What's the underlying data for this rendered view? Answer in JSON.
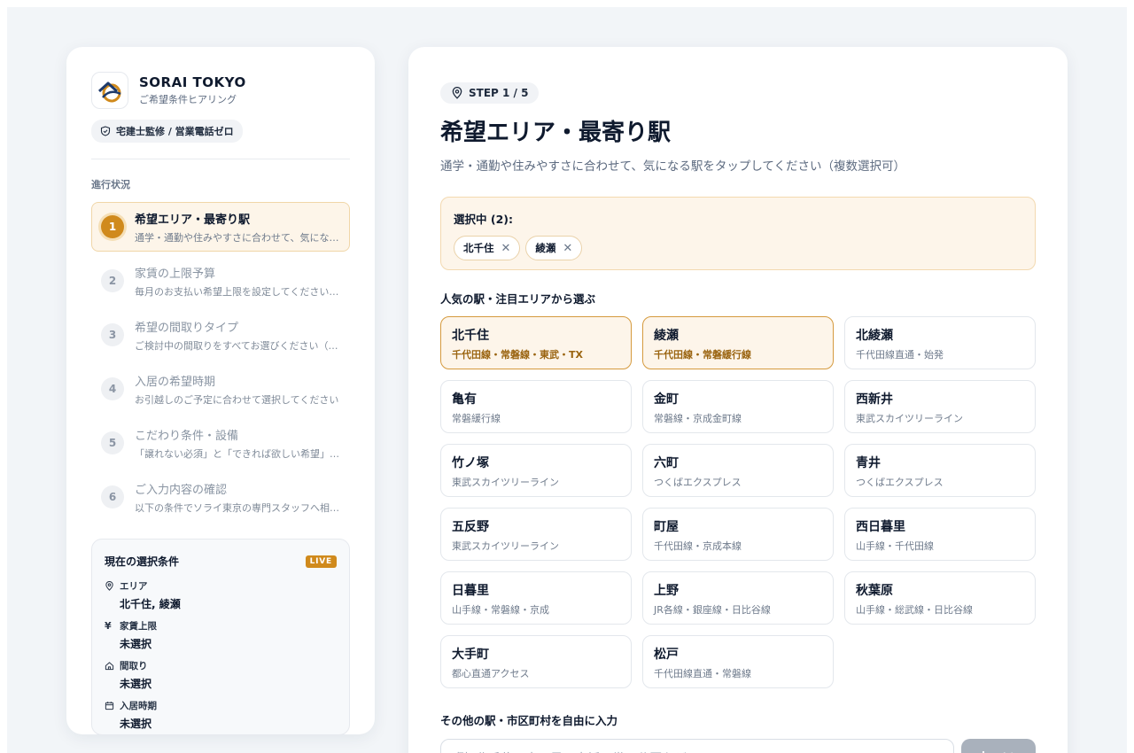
{
  "brand": {
    "name": "SORAI TOKYO",
    "subtitle": "ご希望条件ヒアリング",
    "badge": "宅建士監修 / 営業電話ゼロ"
  },
  "progress": {
    "title": "進行状況",
    "steps": [
      {
        "num": "1",
        "title": "希望エリア・最寄り駅",
        "desc": "通学・通勤や住みやすさに合わせて、気になる駅をタップしてください"
      },
      {
        "num": "2",
        "title": "家賃の上限予算",
        "desc": "毎月のお支払い希望上限を設定してください（管理費込み）"
      },
      {
        "num": "3",
        "title": "希望の間取りタイプ",
        "desc": "ご検討中の間取りをすべてお選びください（複数選択可）"
      },
      {
        "num": "4",
        "title": "入居の希望時期",
        "desc": "お引越しのご予定に合わせて選択してください"
      },
      {
        "num": "5",
        "title": "こだわり条件・設備",
        "desc": "「譲れない必須」と「できれば欲しい希望」を分けてお選びください"
      },
      {
        "num": "6",
        "title": "ご入力内容の確認",
        "desc": "以下の条件でソライ東京の専門スタッフへ相談します"
      }
    ]
  },
  "summary": {
    "title": "現在の選択条件",
    "live": "LIVE",
    "items": [
      {
        "label": "エリア",
        "value": "北千住, 綾瀬",
        "icon": "pin-icon"
      },
      {
        "label": "家賃上限",
        "value": "未選択",
        "icon": "yen-icon"
      },
      {
        "label": "間取り",
        "value": "未選択",
        "icon": "home-icon"
      },
      {
        "label": "入居時期",
        "value": "未選択",
        "icon": "calendar-icon"
      }
    ]
  },
  "main": {
    "step_chip": "STEP 1 / 5",
    "title": "希望エリア・最寄り駅",
    "subtitle": "通学・通勤や住みやすさに合わせて、気になる駅をタップしてください（複数選択可）",
    "selected_label": "選択中 (2):",
    "selected_tags": [
      "北千住",
      "綾瀬"
    ],
    "popular_label": "人気の駅・注目エリアから選ぶ",
    "stations": [
      {
        "name": "北千住",
        "line": "千代田線・常磐線・東武・TX",
        "selected": true
      },
      {
        "name": "綾瀬",
        "line": "千代田線・常磐緩行線",
        "selected": true
      },
      {
        "name": "北綾瀬",
        "line": "千代田線直通・始発",
        "selected": false
      },
      {
        "name": "亀有",
        "line": "常磐緩行線",
        "selected": false
      },
      {
        "name": "金町",
        "line": "常磐線・京成金町線",
        "selected": false
      },
      {
        "name": "西新井",
        "line": "東武スカイツリーライン",
        "selected": false
      },
      {
        "name": "竹ノ塚",
        "line": "東武スカイツリーライン",
        "selected": false
      },
      {
        "name": "六町",
        "line": "つくばエクスプレス",
        "selected": false
      },
      {
        "name": "青井",
        "line": "つくばエクスプレス",
        "selected": false
      },
      {
        "name": "五反野",
        "line": "東武スカイツリーライン",
        "selected": false
      },
      {
        "name": "町屋",
        "line": "千代田線・京成本線",
        "selected": false
      },
      {
        "name": "西日暮里",
        "line": "山手線・千代田線",
        "selected": false
      },
      {
        "name": "日暮里",
        "line": "山手線・常磐線・京成",
        "selected": false
      },
      {
        "name": "上野",
        "line": "JR各線・銀座線・日比谷線",
        "selected": false
      },
      {
        "name": "秋葉原",
        "line": "山手線・総武線・日比谷線",
        "selected": false
      },
      {
        "name": "大手町",
        "line": "都心直通アクセス",
        "selected": false
      },
      {
        "name": "松戸",
        "line": "千代田線直通・常磐線",
        "selected": false
      }
    ],
    "free_label": "その他の駅・市区町村を自由に入力",
    "free_placeholder": "例: 北千住、中目黒、赤坂、世田谷区など",
    "add_label": "追加"
  },
  "colors": {
    "accent": "#d08a1c",
    "accent_bg": "#fdf5ea",
    "text": "#0f1a2e"
  }
}
